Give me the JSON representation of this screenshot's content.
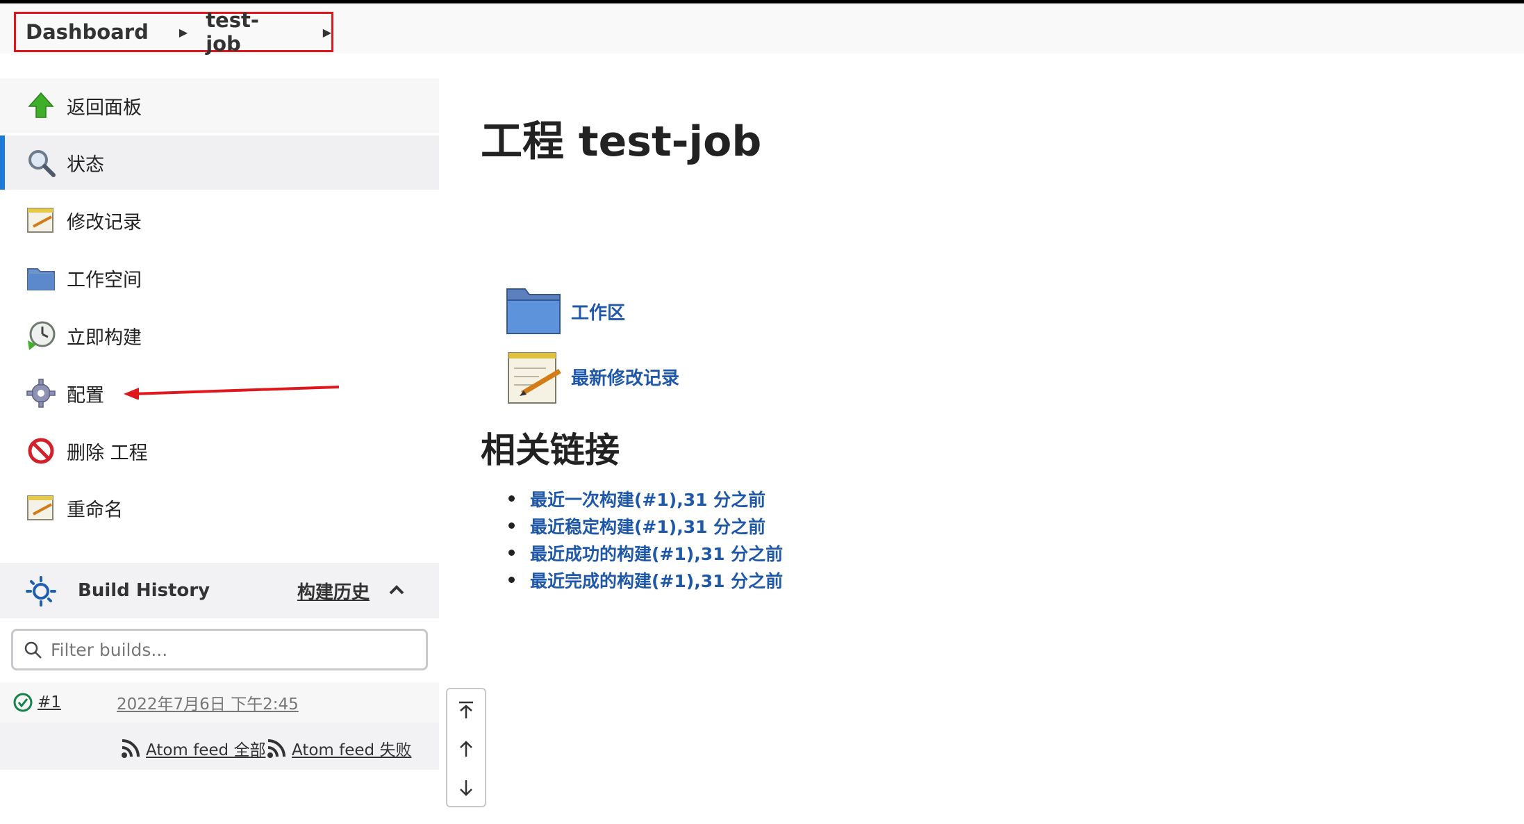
{
  "breadcrumb": {
    "items": [
      {
        "label": "Dashboard"
      },
      {
        "label": "test-job"
      }
    ]
  },
  "sidebar": {
    "tasks": [
      {
        "label": "返回面板",
        "icon": "up-arrow-icon"
      },
      {
        "label": "状态",
        "icon": "search-icon"
      },
      {
        "label": "修改记录",
        "icon": "notepad-icon"
      },
      {
        "label": "工作空间",
        "icon": "folder-icon"
      },
      {
        "label": "立即构建",
        "icon": "clock-icon"
      },
      {
        "label": "配置",
        "icon": "gear-icon"
      },
      {
        "label": "删除 工程",
        "icon": "no-entry-icon"
      },
      {
        "label": "重命名",
        "icon": "notepad-icon"
      }
    ]
  },
  "build_history": {
    "title": "Build History",
    "link": "构建历史",
    "filter_placeholder": "Filter builds...",
    "builds": [
      {
        "number": "#1",
        "date": "2022年7月6日 下午2:45",
        "status": "success"
      }
    ],
    "feeds": [
      {
        "label": "Atom feed 全部"
      },
      {
        "label": "Atom feed 失败"
      }
    ]
  },
  "main": {
    "title": "工程 test-job",
    "links": [
      {
        "label": "工作区",
        "icon": "folder-icon"
      },
      {
        "label": "最新修改记录",
        "icon": "notepad-icon"
      }
    ],
    "related_title": "相关链接",
    "related": [
      "最近一次构建(#1),31 分之前",
      "最近稳定构建(#1),31 分之前",
      "最近成功的构建(#1),31 分之前",
      "最近完成的构建(#1),31 分之前"
    ]
  },
  "colors": {
    "accent": "#1d7ad9",
    "link": "#1f58a8",
    "annotation": "#e0161d",
    "success": "#138347"
  }
}
